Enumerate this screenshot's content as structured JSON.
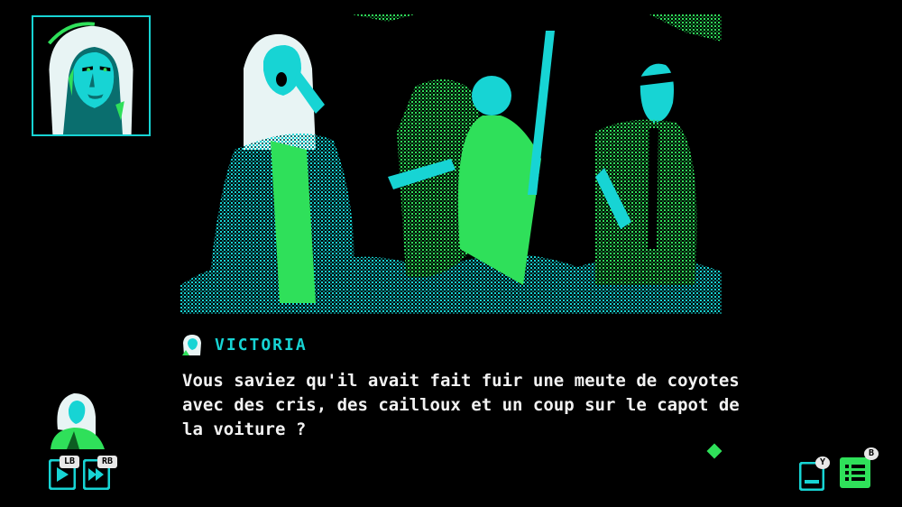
{
  "speaker": {
    "name": "VICTORIA"
  },
  "dialogue": {
    "lines": [
      "Vous saviez qu'il avait fait fuir une meute de coyotes",
      "avec des cris, des cailloux et un coup sur le capot de",
      "la voiture ?"
    ]
  },
  "controls": {
    "auto_badge": "LB",
    "skip_badge": "RB",
    "log_badge": "Y",
    "menu_badge": "B"
  },
  "colors": {
    "cyan": "#17d4d4",
    "green": "#2fe05a",
    "dark_teal": "#0a6e6e",
    "text": "#f2f2f2",
    "background": "#000000"
  },
  "icons": {
    "auto_play": "play-icon",
    "fast_forward": "fast-forward-icon",
    "history": "log-icon",
    "menu": "list-icon",
    "speaker": "portrait-icon",
    "continue": "diamond-icon"
  }
}
